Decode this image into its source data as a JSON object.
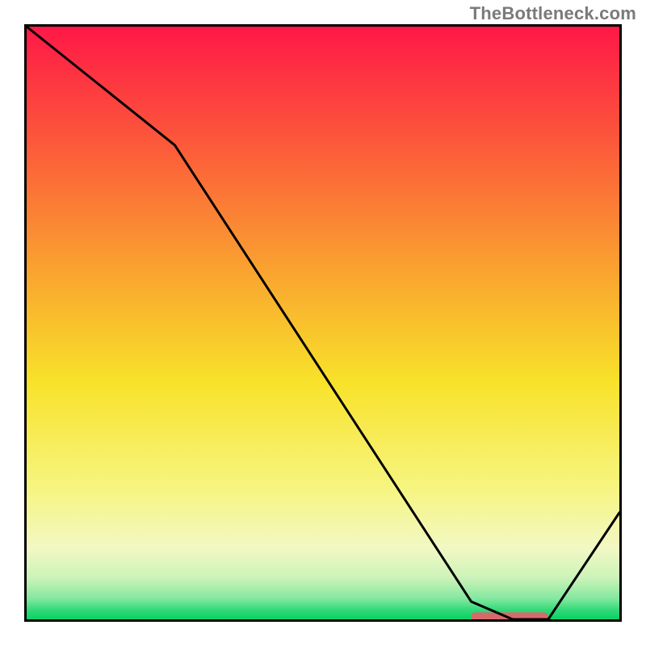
{
  "watermark": "TheBottleneck.com",
  "chart_data": {
    "type": "line",
    "x": [
      0,
      5,
      25,
      75,
      82,
      88,
      100
    ],
    "values": [
      100,
      96,
      80,
      3,
      0,
      0,
      18
    ],
    "title": "",
    "xlabel": "",
    "ylabel": "",
    "xlim": [
      0,
      100
    ],
    "ylim": [
      0,
      100
    ],
    "marker": {
      "x_start": 75,
      "x_end": 88,
      "y": 0.5,
      "color": "#d66a6a"
    },
    "gradient_stops": [
      {
        "offset": 0,
        "color": "#fe1847"
      },
      {
        "offset": 0.2,
        "color": "#fc5a3a"
      },
      {
        "offset": 0.45,
        "color": "#f9b02e"
      },
      {
        "offset": 0.6,
        "color": "#f8e22a"
      },
      {
        "offset": 0.78,
        "color": "#f6f581"
      },
      {
        "offset": 0.88,
        "color": "#f2f8c4"
      },
      {
        "offset": 0.93,
        "color": "#ccf3b9"
      },
      {
        "offset": 0.965,
        "color": "#83e89f"
      },
      {
        "offset": 0.985,
        "color": "#2fd977"
      },
      {
        "offset": 1.0,
        "color": "#09d164"
      }
    ]
  }
}
